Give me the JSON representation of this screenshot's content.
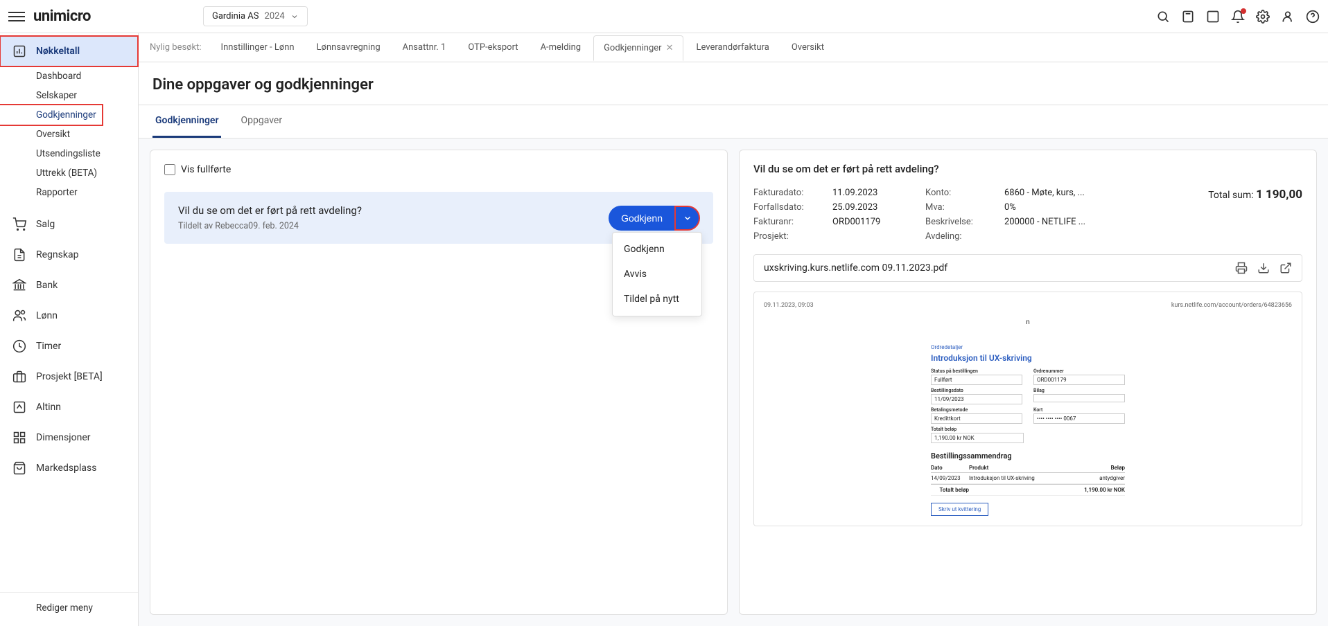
{
  "logo": "unimicro",
  "company": {
    "name": "Gardinia AS",
    "year": "2024"
  },
  "recent_label": "Nylig besøkt:",
  "tabs": [
    {
      "label": "Innstillinger - Lønn"
    },
    {
      "label": "Lønnsavregning"
    },
    {
      "label": "Ansattnr. 1"
    },
    {
      "label": "OTP-eksport"
    },
    {
      "label": "A-melding"
    },
    {
      "label": "Godkjenninger",
      "active": true
    },
    {
      "label": "Leverandørfaktura"
    },
    {
      "label": "Oversikt"
    }
  ],
  "sidebar": {
    "nokkeltall": "Nøkkeltall",
    "sub": [
      "Dashboard",
      "Selskaper",
      "Godkjenninger",
      "Oversikt",
      "Utsendingsliste",
      "Uttrekk (BETA)",
      "Rapporter"
    ],
    "items": [
      "Salg",
      "Regnskap",
      "Bank",
      "Lønn",
      "Timer",
      "Prosjekt [BETA]",
      "Altinn",
      "Dimensjoner",
      "Markedsplass"
    ],
    "footer": "Rediger meny"
  },
  "page_title": "Dine oppgaver og godkjenninger",
  "inner_tabs": [
    "Godkjenninger",
    "Oppgaver"
  ],
  "show_completed": "Vis fullførte",
  "task": {
    "title": "Vil du se om det er ført på rett avdeling?",
    "meta": "Tildelt av Rebecca09. feb. 2024",
    "approve": "Godkjenn",
    "menu": [
      "Godkjenn",
      "Avvis",
      "Tildel på nytt"
    ]
  },
  "detail": {
    "title": "Vil du se om det er ført på rett avdeling?",
    "labels": {
      "fakturadato": "Fakturadato:",
      "forfallsdato": "Forfallsdato:",
      "fakturanr": "Fakturanr:",
      "prosjekt": "Prosjekt:",
      "konto": "Konto:",
      "mva": "Mva:",
      "beskrivelse": "Beskrivelse:",
      "avdeling": "Avdeling:"
    },
    "values": {
      "fakturadato": "11.09.2023",
      "forfallsdato": "25.09.2023",
      "fakturanr": "ORD001179",
      "konto": "6860 - Møte, kurs, ...",
      "mva": "0%",
      "beskrivelse": "200000 - NETLIFE ..."
    },
    "total_label": "Total sum:",
    "total_value": "1 190,00",
    "filename": "uxskriving.kurs.netlife.com 09.11.2023.pdf"
  },
  "pdf": {
    "date": "09.11.2023, 09:03",
    "url": "kurs.netlife.com/account/orders/64823656",
    "logo": "n",
    "link": "Ordredetaljer",
    "heading": "Introduksjon til UX-skriving",
    "status_lbl": "Status på bestillingen",
    "status_val": "Fullført",
    "ordrenr_lbl": "Ordrenummer",
    "ordrenr_val": "ORD001179",
    "bdato_lbl": "Bestillingsdato",
    "bdato_val": "11/09/2023",
    "bilag_lbl": "Bilag",
    "bilag_val": "",
    "metode_lbl": "Betalingsmetode",
    "metode_val": "Kredittkort",
    "kort_lbl": "Kort",
    "kort_val": "•••• •••• •••• 0067",
    "tbelop_lbl": "Totalt beløp",
    "tbelop_val": "1,190.00 kr NOK",
    "summary_h": "Bestillingssammendrag",
    "col_dato": "Dato",
    "col_produkt": "Produkt",
    "col_belop": "Beløp",
    "row_dato": "14/09/2023",
    "row_prod": "Introduksjon til UX-skriving",
    "row_belop": "antydgiver",
    "total_lbl": "Totalt beløp",
    "total_val": "1,190.00 kr NOK",
    "btn": "Skriv ut kvittering"
  }
}
